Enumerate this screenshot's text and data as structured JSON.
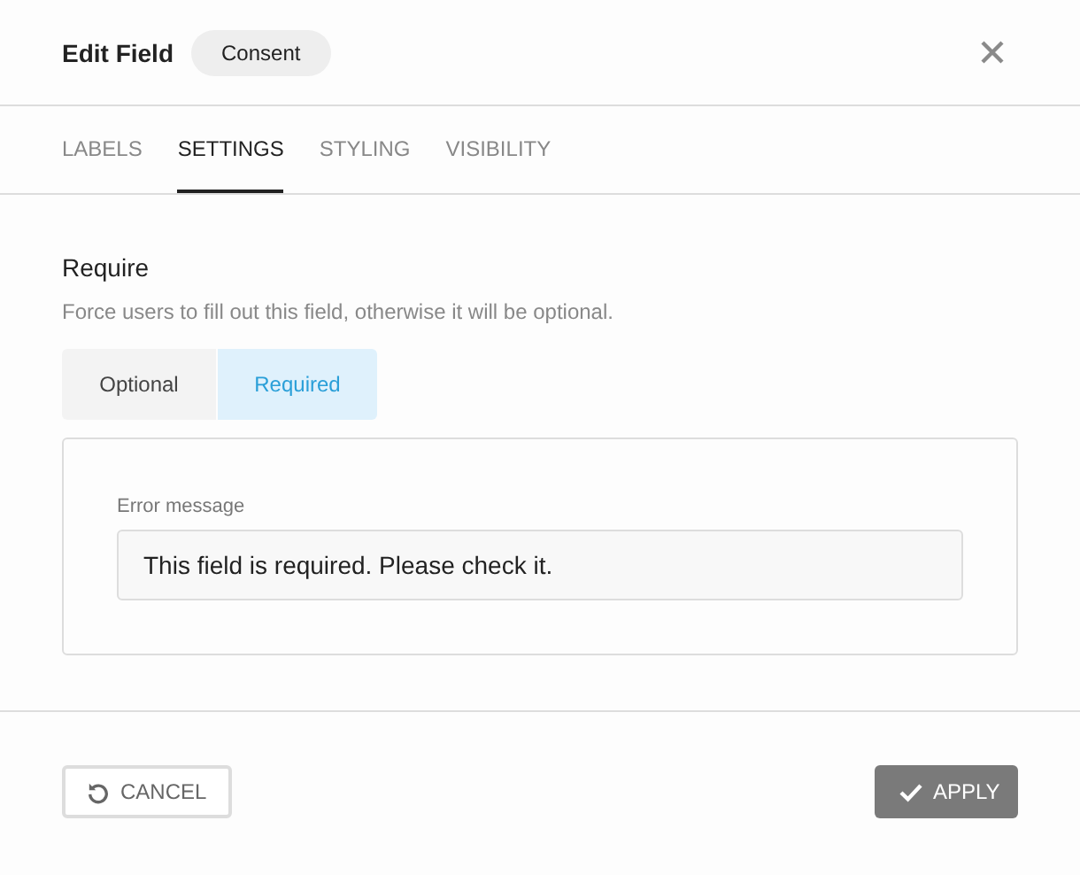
{
  "header": {
    "title": "Edit Field",
    "badge": "Consent"
  },
  "tabs": [
    {
      "label": "LABELS",
      "selected": false
    },
    {
      "label": "SETTINGS",
      "selected": true
    },
    {
      "label": "STYLING",
      "selected": false
    },
    {
      "label": "VISIBILITY",
      "selected": false
    }
  ],
  "section": {
    "title": "Require",
    "description": "Force users to fill out this field, otherwise it will be optional.",
    "options": [
      {
        "label": "Optional",
        "selected": false
      },
      {
        "label": "Required",
        "selected": true
      }
    ],
    "error_message": {
      "label": "Error message",
      "value": "This field is required. Please check it."
    }
  },
  "footer": {
    "cancel": "CANCEL",
    "apply": "APPLY"
  }
}
